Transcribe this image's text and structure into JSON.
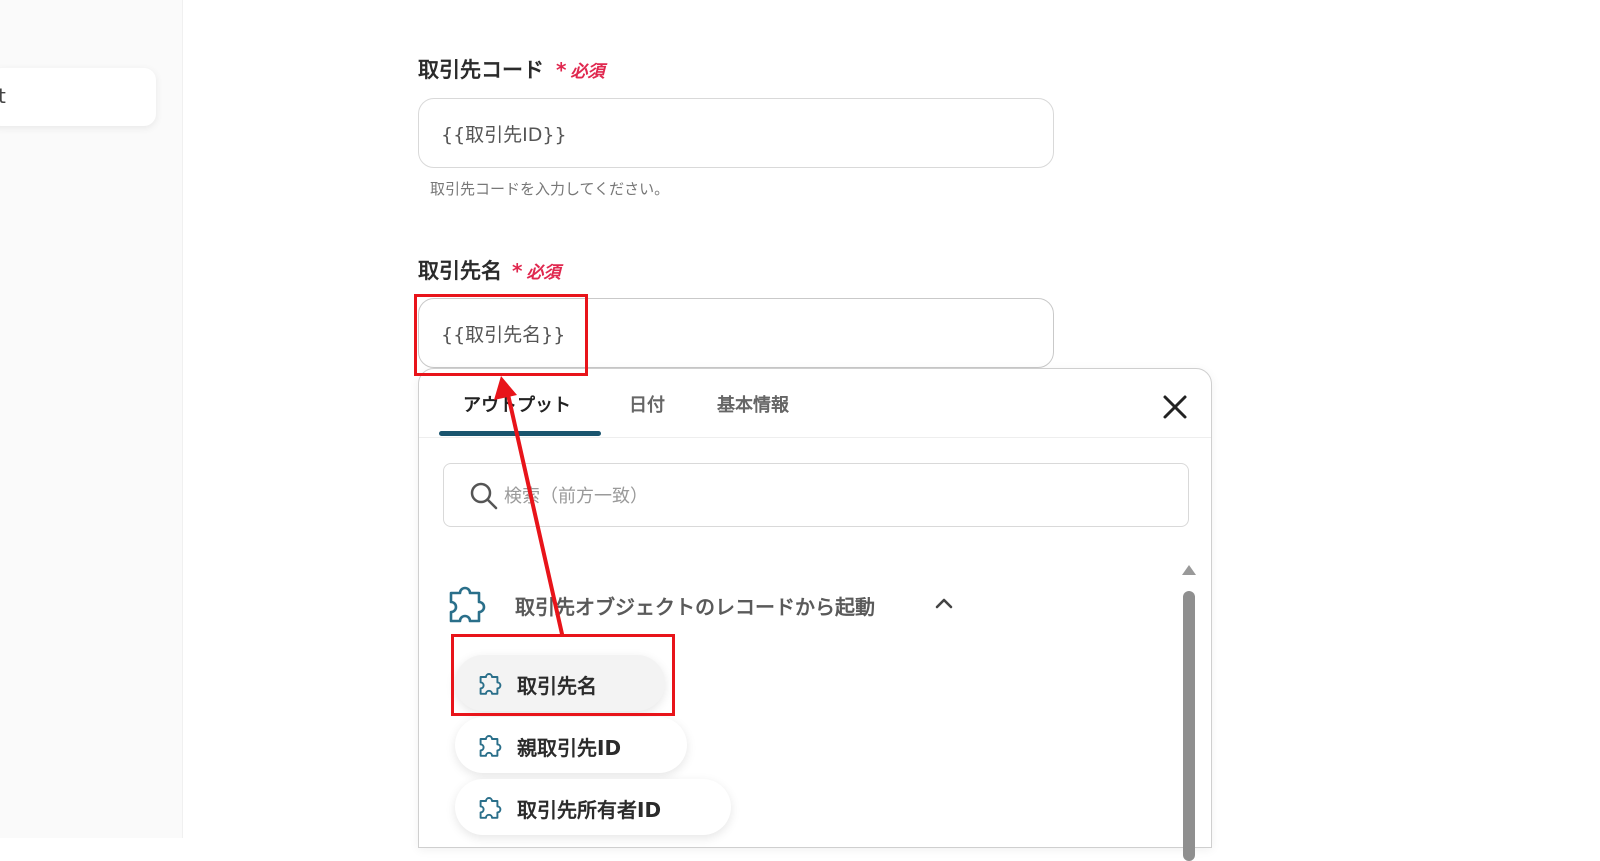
{
  "sidebar": {
    "active_item_label": "t"
  },
  "form": {
    "fields": [
      {
        "label": "取引先コード",
        "required_label": "必須",
        "value": "{{取引先ID}}",
        "hint": "取引先コードを入力してください。"
      },
      {
        "label": "取引先名",
        "required_label": "必須",
        "value": "{{取引先名}}"
      }
    ]
  },
  "picker": {
    "tabs": [
      {
        "label": "アウトプット",
        "active": true
      },
      {
        "label": "日付",
        "active": false
      },
      {
        "label": "基本情報",
        "active": false
      }
    ],
    "search_placeholder": "検索（前方一致）",
    "group_title": "取引先オブジェクトのレコードから起動",
    "items": [
      {
        "label": "取引先名",
        "selected": true
      },
      {
        "label": "親取引先ID",
        "selected": false
      },
      {
        "label": "取引先所有者ID",
        "selected": false
      }
    ]
  },
  "colors": {
    "required": "#e0284f",
    "tab_underline": "#19546e",
    "annotation": "#e8141a",
    "icon": "#2a6f8a"
  },
  "icons": [
    "close-icon",
    "search-icon",
    "puzzle-icon",
    "chevron-up-icon"
  ]
}
